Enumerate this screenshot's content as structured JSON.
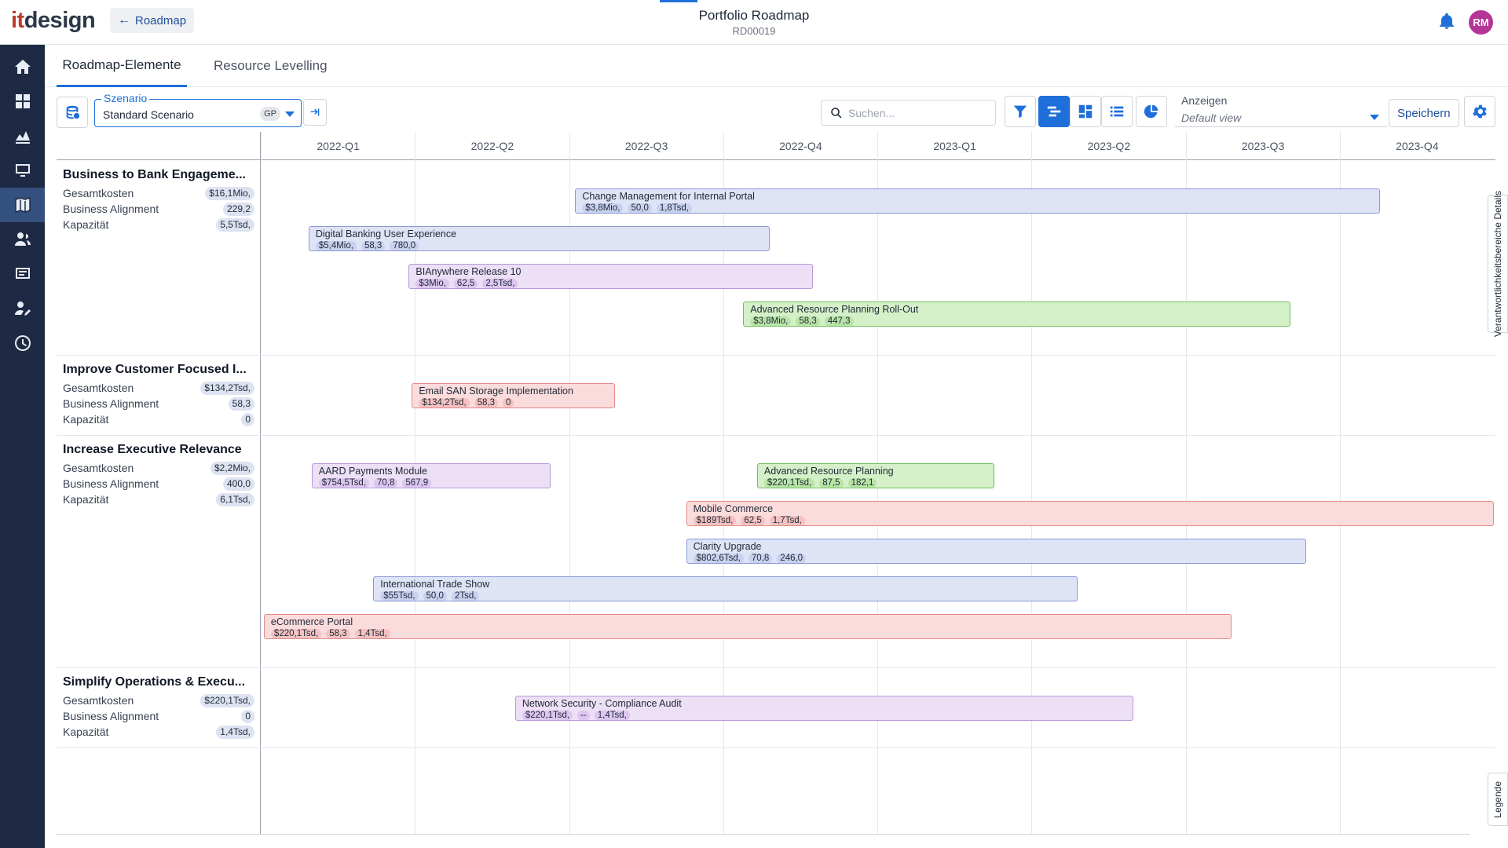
{
  "header": {
    "logo_it": "it",
    "logo_design": "design",
    "back_label": "Roadmap",
    "title": "Portfolio Roadmap",
    "subtitle": "RD00019",
    "avatar_initials": "RM"
  },
  "sidebar": {
    "items": [
      {
        "icon": "home-icon"
      },
      {
        "icon": "dashboard-icon"
      },
      {
        "icon": "chart-area-icon"
      },
      {
        "icon": "monitor-icon"
      },
      {
        "icon": "map-icon",
        "active": true
      },
      {
        "icon": "users-icon"
      },
      {
        "icon": "list-card-icon"
      },
      {
        "icon": "user-edit-icon"
      },
      {
        "icon": "clock-icon"
      }
    ]
  },
  "tabs": [
    {
      "label": "Roadmap-Elemente",
      "active": true
    },
    {
      "label": "Resource Levelling",
      "active": false
    }
  ],
  "toolbar": {
    "scenario_label": "Szenario",
    "scenario_value": "Standard Scenario",
    "scenario_badge": "GP",
    "search_placeholder": "Suchen...",
    "view_label": "Anzeigen",
    "view_value": "Default view",
    "save_label": "Speichern"
  },
  "quarters": [
    "2022-Q1",
    "2022-Q2",
    "2022-Q3",
    "2022-Q4",
    "2023-Q1",
    "2023-Q2",
    "2023-Q3",
    "2023-Q4"
  ],
  "metric_labels": {
    "cost": "Gesamtkosten",
    "alignment": "Business Alignment",
    "capacity": "Kapazität"
  },
  "groups": [
    {
      "title": "Business to Bank Engageme...",
      "cost": "$16,1Mio,",
      "alignment": "229,2",
      "capacity": "5,5Tsd,",
      "bars": [
        {
          "name": "Change Management for Internal Portal",
          "color": "blue",
          "chips": [
            "$3,8Mio,",
            "50,0",
            "1,8Tsd,"
          ],
          "start": 2.04,
          "end": 7.26
        },
        {
          "name": "Digital Banking User Experience",
          "color": "blue",
          "chips": [
            "$5,4Mio,",
            "58,3",
            "780,0"
          ],
          "start": 0.31,
          "end": 3.3
        },
        {
          "name": "BIAnywhere Release 10",
          "color": "purple",
          "chips": [
            "$3Mio,",
            "62,5",
            "2,5Tsd,"
          ],
          "start": 0.96,
          "end": 3.58
        },
        {
          "name": "Advanced Resource Planning Roll-Out",
          "color": "green",
          "chips": [
            "$3,8Mio,",
            "58,3",
            "447,3"
          ],
          "start": 3.13,
          "end": 6.68
        }
      ]
    },
    {
      "title": "Improve Customer Focused I...",
      "cost": "$134,2Tsd,",
      "alignment": "58,3",
      "capacity": "0",
      "bars": [
        {
          "name": "Email SAN Storage Implementation",
          "color": "red",
          "chips": [
            "$134,2Tsd,",
            "58,3",
            "0"
          ],
          "start": 0.98,
          "end": 2.3
        }
      ]
    },
    {
      "title": "Increase Executive Relevance",
      "cost": "$2,2Mio,",
      "alignment": "400,0",
      "capacity": "6,1Tsd,",
      "bars": [
        {
          "name": "AARD Payments Module",
          "color": "purple",
          "chips": [
            "$754,5Tsd,",
            "70,8",
            "567,9"
          ],
          "start": 0.33,
          "end": 1.88
        },
        {
          "name": "Advanced Resource Planning",
          "color": "green",
          "chips": [
            "$220,1Tsd,",
            "87,5",
            "182,1"
          ],
          "start": 3.22,
          "end": 4.76
        },
        {
          "name": "Mobile Commerce",
          "color": "red",
          "chips": [
            "$189Tsd,",
            "62,5",
            "1,7Tsd,"
          ],
          "start": 2.76,
          "end": 8.0
        },
        {
          "name": "Clarity Upgrade",
          "color": "blue",
          "chips": [
            "$802,6Tsd,",
            "70,8",
            "246,0"
          ],
          "start": 2.76,
          "end": 6.78
        },
        {
          "name": "International Trade Show",
          "color": "blue",
          "chips": [
            "$55Tsd,",
            "50,0",
            "2Tsd,"
          ],
          "start": 0.73,
          "end": 5.3
        },
        {
          "name": "eCommerce Portal",
          "color": "red",
          "chips": [
            "$220,1Tsd,",
            "58,3",
            "1,4Tsd,"
          ],
          "start": 0.02,
          "end": 6.3
        }
      ]
    },
    {
      "title": "Simplify Operations & Execu...",
      "cost": "$220,1Tsd,",
      "alignment": "0",
      "capacity": "1,4Tsd,",
      "bars": [
        {
          "name": "Network Security - Compliance Audit",
          "color": "purple",
          "chips": [
            "$220,1Tsd,",
            "--",
            "1,4Tsd,"
          ],
          "start": 1.65,
          "end": 5.66
        }
      ]
    }
  ],
  "side_tabs": {
    "details": "Verantwortlichkeitsbereiche  Details",
    "legend": "Legende"
  }
}
